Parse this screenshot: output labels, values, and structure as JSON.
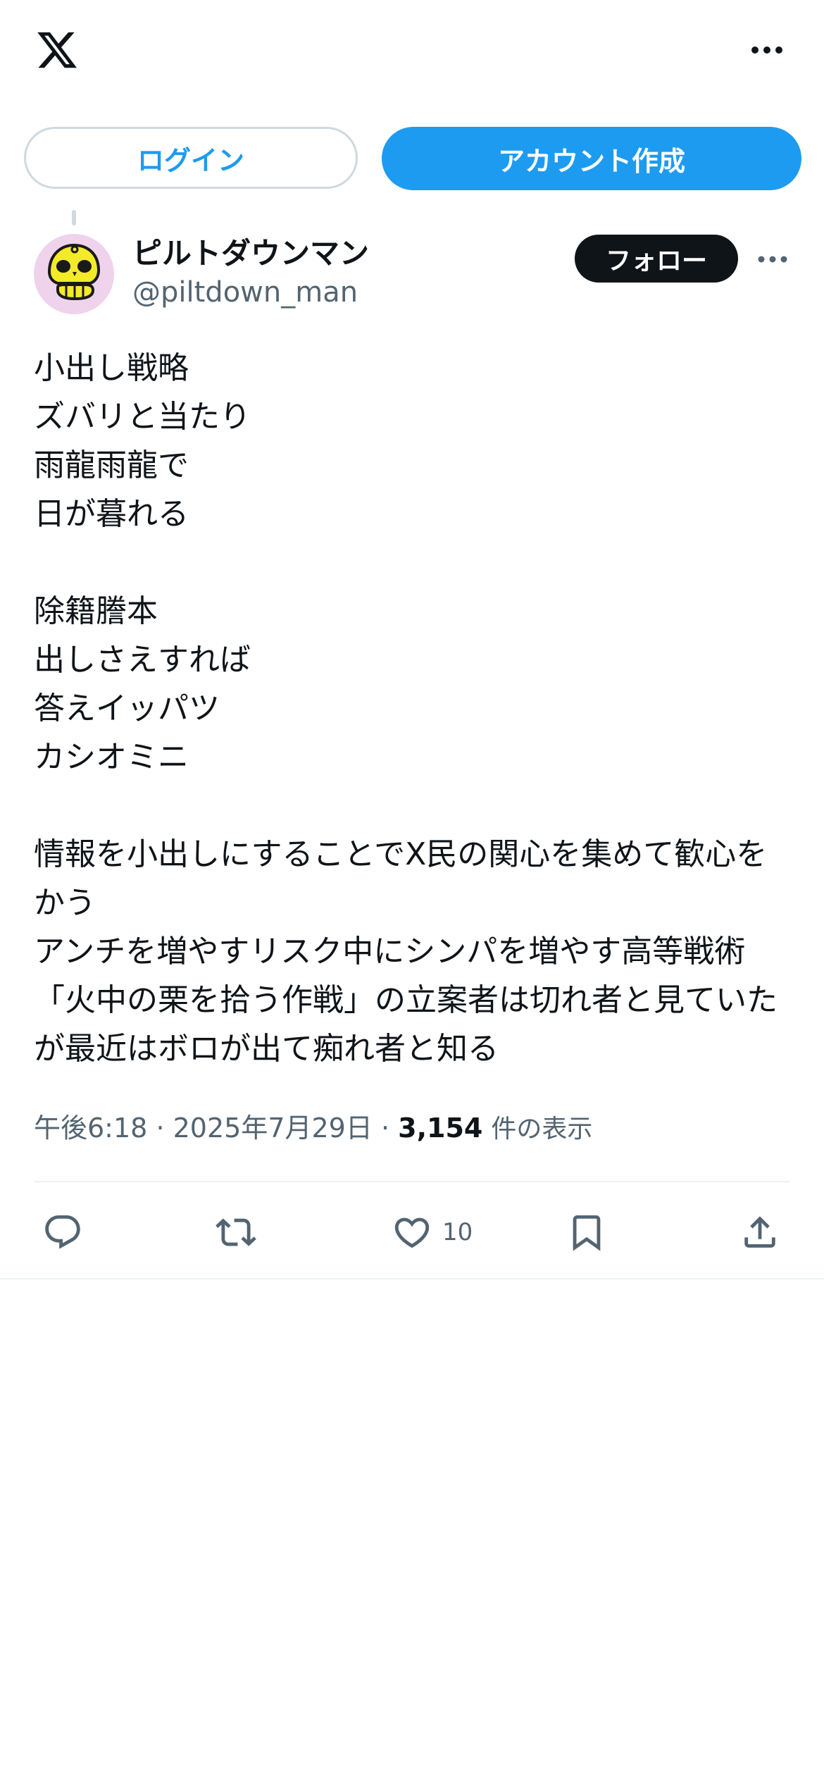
{
  "header": {
    "logo": "x-logo-icon",
    "more_icon": "more-horizontal-icon"
  },
  "auth": {
    "login_label": "ログイン",
    "signup_label": "アカウント作成"
  },
  "post": {
    "author": {
      "display_name": "ピルトダウンマン",
      "handle": "@piltdown_man",
      "avatar": "skull-avatar"
    },
    "follow_label": "フォロー",
    "text": "小出し戦略\nズバリと当たり\n雨龍雨龍で\n日が暮れる\n\n除籍謄本\n出しさえすれば\n答えイッパツ\nカシオミニ\n\n情報を小出しにすることでX民の関心を集めて歓心をかう\nアンチを増やすリスク中にシンパを増やす高等戦術「火中の栗を拾う作戦」の立案者は切れ者と見ていたが最近はボロが出て痴れ者と知る",
    "time": "午後6:18",
    "date": "2025年7月29日",
    "views_count": "3,154",
    "views_label": "件の表示",
    "actions": {
      "reply_icon": "reply-icon",
      "repost_icon": "repost-icon",
      "like_icon": "heart-icon",
      "like_count": "10",
      "bookmark_icon": "bookmark-icon",
      "share_icon": "share-icon"
    }
  },
  "colors": {
    "accent": "#1d9bf0",
    "text_primary": "#0f1419",
    "text_secondary": "#536471",
    "border": "#cfd9de",
    "avatar_bg": "#efd3ec"
  }
}
